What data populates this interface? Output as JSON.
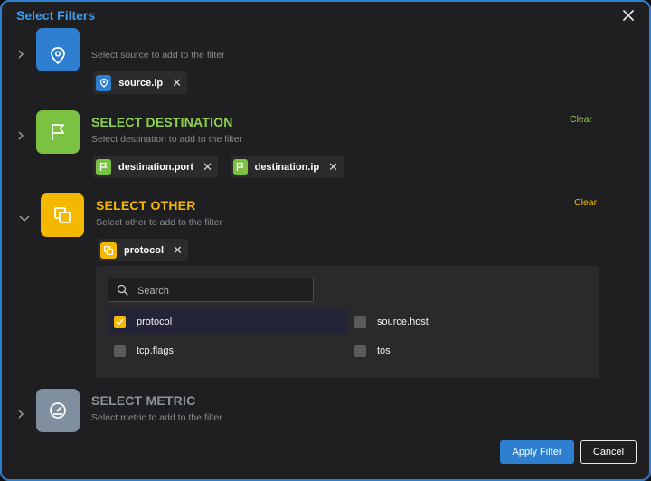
{
  "dialog": {
    "title": "Select Filters"
  },
  "sections": {
    "source": {
      "title": "",
      "subtitle": "Select source to add to the filter",
      "chips": [
        {
          "label": "source.ip"
        }
      ],
      "color": "#2f7fd0",
      "icon": "location-pin-icon"
    },
    "destination": {
      "title": "SELECT DESTINATION",
      "subtitle": "Select destination to add to the filter",
      "clear_label": "Clear",
      "chips": [
        {
          "label": "destination.port"
        },
        {
          "label": "destination.ip"
        }
      ],
      "color": "#7cc242",
      "icon": "flag-icon"
    },
    "other": {
      "title": "SELECT OTHER",
      "subtitle": "Select other to add to the filter",
      "clear_label": "Clear",
      "chips": [
        {
          "label": "protocol"
        }
      ],
      "color": "#f5b800",
      "icon": "copy-squares-icon",
      "search_placeholder": "Search",
      "options": [
        {
          "label": "protocol",
          "checked": true
        },
        {
          "label": "source.host",
          "checked": false
        },
        {
          "label": "tcp.flags",
          "checked": false
        },
        {
          "label": "tos",
          "checked": false
        }
      ]
    },
    "metric": {
      "title": "SELECT METRIC",
      "subtitle": "Select metric to add to the filter",
      "color": "#7f8fa0",
      "icon": "gauge-icon"
    }
  },
  "footer": {
    "apply_label": "Apply Filter",
    "cancel_label": "Cancel"
  }
}
